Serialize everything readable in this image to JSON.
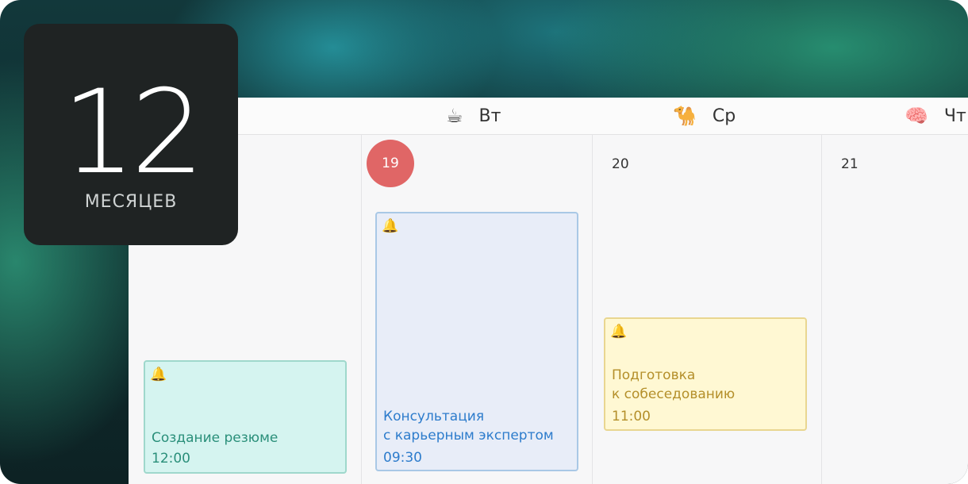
{
  "badge": {
    "number": "12",
    "label": "МЕСЯЦЕВ"
  },
  "days": [
    {
      "emoji": "☕",
      "label": "Вт"
    },
    {
      "emoji": "🐪",
      "label": "Ср"
    },
    {
      "emoji": "🧠",
      "label": "Чт"
    }
  ],
  "dates": {
    "tue": "19",
    "wed": "20",
    "thu": "21"
  },
  "events": {
    "resume": {
      "icon": "🔔",
      "title": "Создание резюме",
      "time": "12:00"
    },
    "consult": {
      "icon": "🔔",
      "title_line1": "Консультация",
      "title_line2": "с карьерным экспертом",
      "time": "09:30"
    },
    "prep": {
      "icon": "🔔",
      "title_line1": "Подготовка",
      "title_line2": "к собеседованию",
      "time": "11:00"
    }
  },
  "colors": {
    "today_circle": "#e06666",
    "event_green": "#2a8f7a",
    "event_blue": "#2d7ccc",
    "event_yellow": "#b48f2a"
  }
}
